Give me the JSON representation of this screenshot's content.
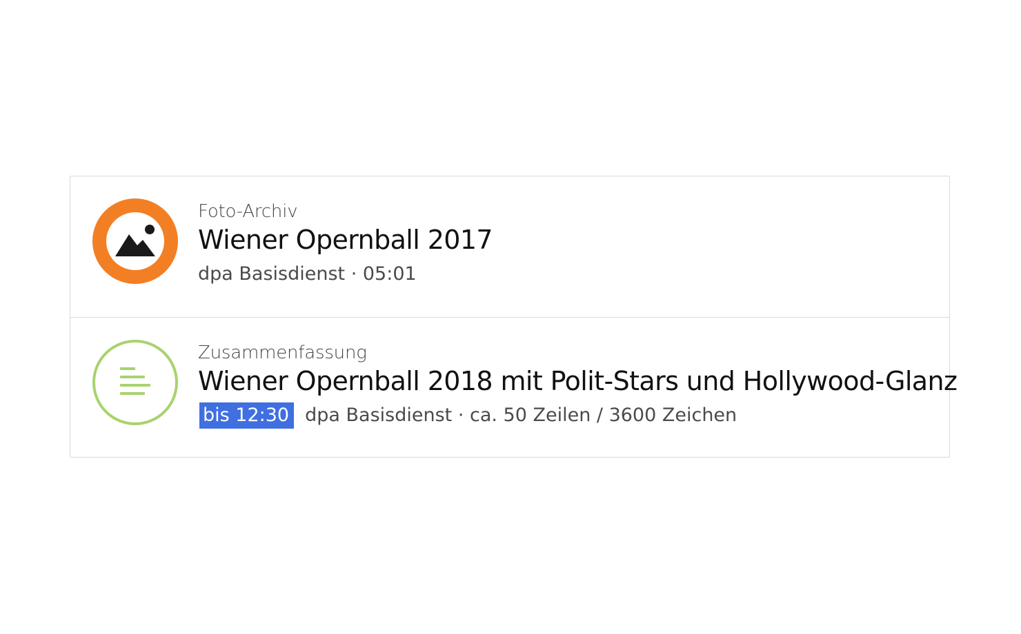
{
  "feed": {
    "items": [
      {
        "icon": "photo-icon",
        "icon_color": "#f27f24",
        "category": "Foto-Archiv",
        "headline": "Wiener Opernball 2017",
        "meta": "dpa Basisdienst · 05:01"
      },
      {
        "icon": "text-lines-icon",
        "icon_color": "#a9d26e",
        "category": "Zusammenfassung",
        "headline": "Wiener Opernball 2018 mit Polit-Stars und Hollywood-Glanz",
        "deadline": "bis 12:30",
        "deadline_color": "#3f6fe0",
        "meta": "dpa Basisdienst · ca. 50 Zeilen / 3600 Zeichen"
      }
    ]
  }
}
